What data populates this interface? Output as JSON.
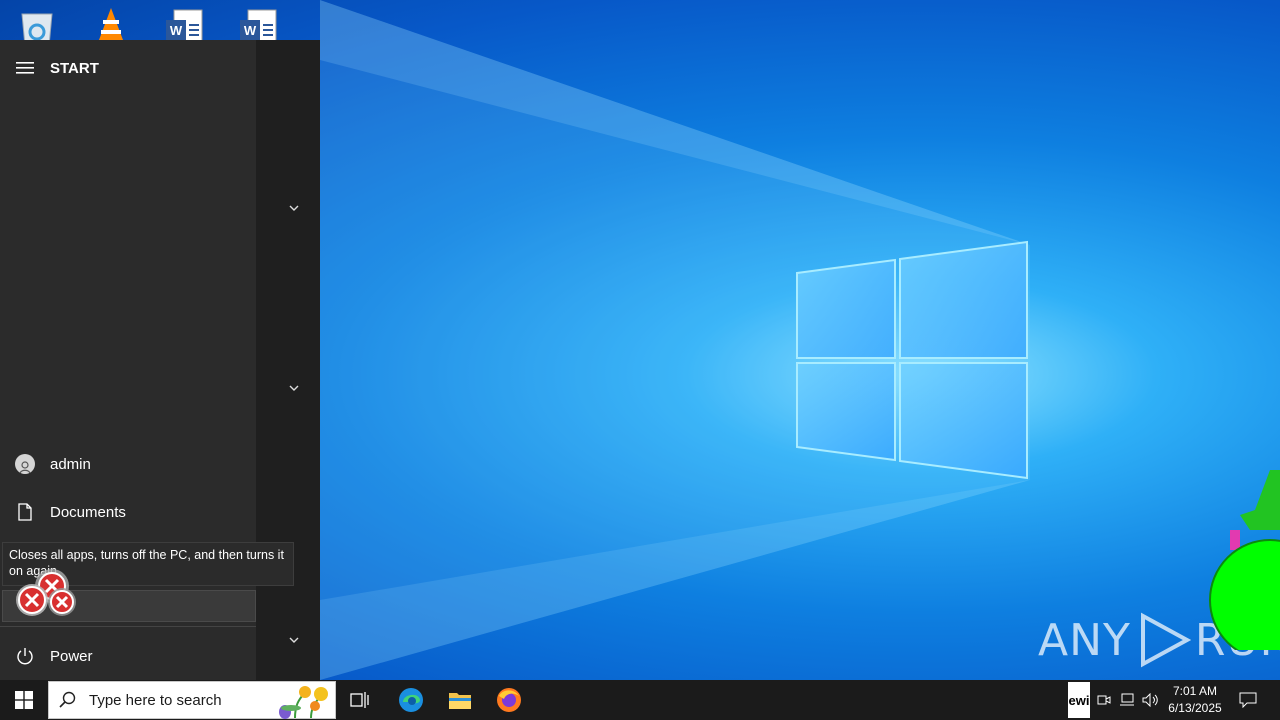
{
  "start_menu": {
    "title": "START",
    "user_label": "admin",
    "documents_label": "Documents",
    "power_label": "Power",
    "tooltip_text": "Closes all apps, turns off the PC, and then turns it on again."
  },
  "taskbar": {
    "search_placeholder": "Type here to search",
    "time": "7:01 AM",
    "date": "6/13/2025",
    "ime_text": "ewi"
  },
  "watermark": {
    "left": "ANY",
    "right": "RUN"
  },
  "desktop_icons": [
    "recycle-bin-icon",
    "vlc-icon",
    "word-document-icon",
    "word-document-icon"
  ],
  "colors": {
    "start_bg": "#1f1f1f",
    "start_rail": "#2b2b2b",
    "taskbar": "#1b1b1b",
    "accent_blue": "#0078d7"
  }
}
